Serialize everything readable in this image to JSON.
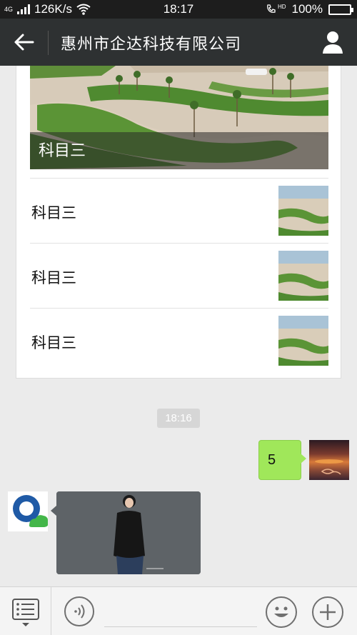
{
  "status_bar": {
    "network": "4G",
    "speed": "126K/s",
    "time": "18:17",
    "call_badge": "HD",
    "battery": "100%"
  },
  "nav": {
    "title": "惠州市企达科技有限公司",
    "back_icon": "arrow-left-icon",
    "profile_icon": "user-icon"
  },
  "article": {
    "hero_caption": "科目三",
    "items": [
      {
        "label": "科目三"
      },
      {
        "label": "科目三"
      },
      {
        "label": "科目三"
      }
    ]
  },
  "chat": {
    "timestamp": "18:16",
    "outgoing_text": "5"
  },
  "input_bar": {
    "menu_icon": "list-menu-icon",
    "voice_icon": "voice-icon",
    "emoji_icon": "emoji-icon",
    "plus_icon": "plus-icon"
  },
  "colors": {
    "navbar": "#2e3132",
    "outgoing_bubble": "#a0e75a",
    "background": "#ebebeb"
  }
}
